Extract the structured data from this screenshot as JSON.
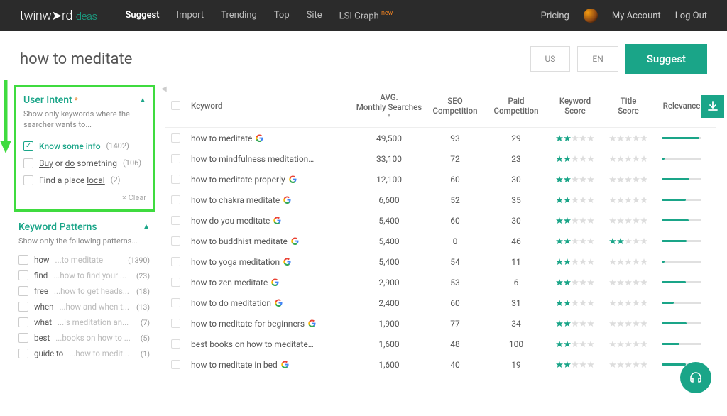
{
  "header": {
    "logo_main": "twinw",
    "logo_arrow": "➤",
    "logo_rd": "rd",
    "logo_ideas": "ideas",
    "nav": [
      "Suggest",
      "Import",
      "Trending",
      "Top",
      "Site",
      "LSI Graph"
    ],
    "nav_new": "new",
    "pricing": "Pricing",
    "account": "My Account",
    "logout": "Log Out"
  },
  "search": {
    "query": "how to meditate",
    "region": "US",
    "lang": "EN",
    "suggest_btn": "Suggest"
  },
  "intent_panel": {
    "title": "User Intent",
    "subtitle": "Show only keywords where the searcher wants to...",
    "clear": "× Clear",
    "items": [
      {
        "checked": true,
        "pre": "Know",
        "post": " some info",
        "count": "(1402)",
        "highlighted": true
      },
      {
        "checked": false,
        "pre": "Buy",
        "mid": " or ",
        "pre2": "do",
        "post": " something",
        "count": "(106)"
      },
      {
        "checked": false,
        "post": "Find a place ",
        "pre": "local",
        "count": "(2)"
      }
    ]
  },
  "patterns_panel": {
    "title": "Keyword Patterns",
    "subtitle": "Show only the following patterns...",
    "items": [
      {
        "lead": "how",
        "rest": "...to meditate",
        "count": "(1390)"
      },
      {
        "lead": "find",
        "rest": "...how to find your ...",
        "count": "(23)"
      },
      {
        "lead": "free",
        "rest": "...how to get heads...",
        "count": "(18)"
      },
      {
        "lead": "when",
        "rest": "...how and when t...",
        "count": "(13)"
      },
      {
        "lead": "what",
        "rest": "...is meditation an...",
        "count": "(7)"
      },
      {
        "lead": "best",
        "rest": "...books on how to ...",
        "count": "(5)"
      },
      {
        "lead": "guide to",
        "rest": "...how to medit...",
        "count": "(1)"
      }
    ]
  },
  "table": {
    "headers": {
      "keyword": "Keyword",
      "avg1": "AVG.",
      "avg2": "Monthly Searches",
      "seo1": "SEO",
      "seo2": "Competition",
      "paid1": "Paid",
      "paid2": "Competition",
      "kscore1": "Keyword",
      "kscore2": "Score",
      "tscore1": "Title",
      "tscore2": "Score",
      "relevance": "Relevance"
    },
    "rows": [
      {
        "keyword": "how to meditate",
        "g": true,
        "avg": "49,500",
        "seo": "93",
        "paid": "29",
        "ks": 2,
        "ts": 0,
        "rel": 95
      },
      {
        "keyword": "how to mindfulness meditation…",
        "g": false,
        "avg": "33,100",
        "seo": "72",
        "paid": "23",
        "ks": 2,
        "ts": 0,
        "rel": 8
      },
      {
        "keyword": "how to meditate properly",
        "g": true,
        "avg": "12,100",
        "seo": "60",
        "paid": "30",
        "ks": 2,
        "ts": 0,
        "rel": 70
      },
      {
        "keyword": "how to chakra meditate",
        "g": true,
        "avg": "6,600",
        "seo": "52",
        "paid": "35",
        "ks": 2,
        "ts": 0,
        "rel": 60
      },
      {
        "keyword": "how do you meditate",
        "g": true,
        "avg": "5,400",
        "seo": "60",
        "paid": "30",
        "ks": 2,
        "ts": 0,
        "rel": 68
      },
      {
        "keyword": "how to buddhist meditate",
        "g": true,
        "avg": "5,400",
        "seo": "0",
        "paid": "46",
        "ks": 2,
        "ts": 2,
        "rel": 62
      },
      {
        "keyword": "how to yoga meditation",
        "g": true,
        "avg": "5,400",
        "seo": "54",
        "paid": "11",
        "ks": 2,
        "ts": 0,
        "rel": 8
      },
      {
        "keyword": "how to zen meditate",
        "g": true,
        "avg": "2,900",
        "seo": "53",
        "paid": "6",
        "ks": 2,
        "ts": 0,
        "rel": 60
      },
      {
        "keyword": "how to do meditation",
        "g": true,
        "avg": "2,400",
        "seo": "60",
        "paid": "31",
        "ks": 2,
        "ts": 0,
        "rel": 30
      },
      {
        "keyword": "how to meditate for beginners",
        "g": true,
        "avg": "1,900",
        "seo": "77",
        "paid": "34",
        "ks": 2,
        "ts": 0,
        "rel": 62
      },
      {
        "keyword": "best books on how to meditate…",
        "g": false,
        "avg": "1,600",
        "seo": "48",
        "paid": "100",
        "ks": 2,
        "ts": 0,
        "rel": 45
      },
      {
        "keyword": "how to meditate in bed",
        "g": true,
        "avg": "1,600",
        "seo": "40",
        "paid": "19",
        "ks": 2,
        "ts": 0,
        "rel": 60
      }
    ]
  }
}
